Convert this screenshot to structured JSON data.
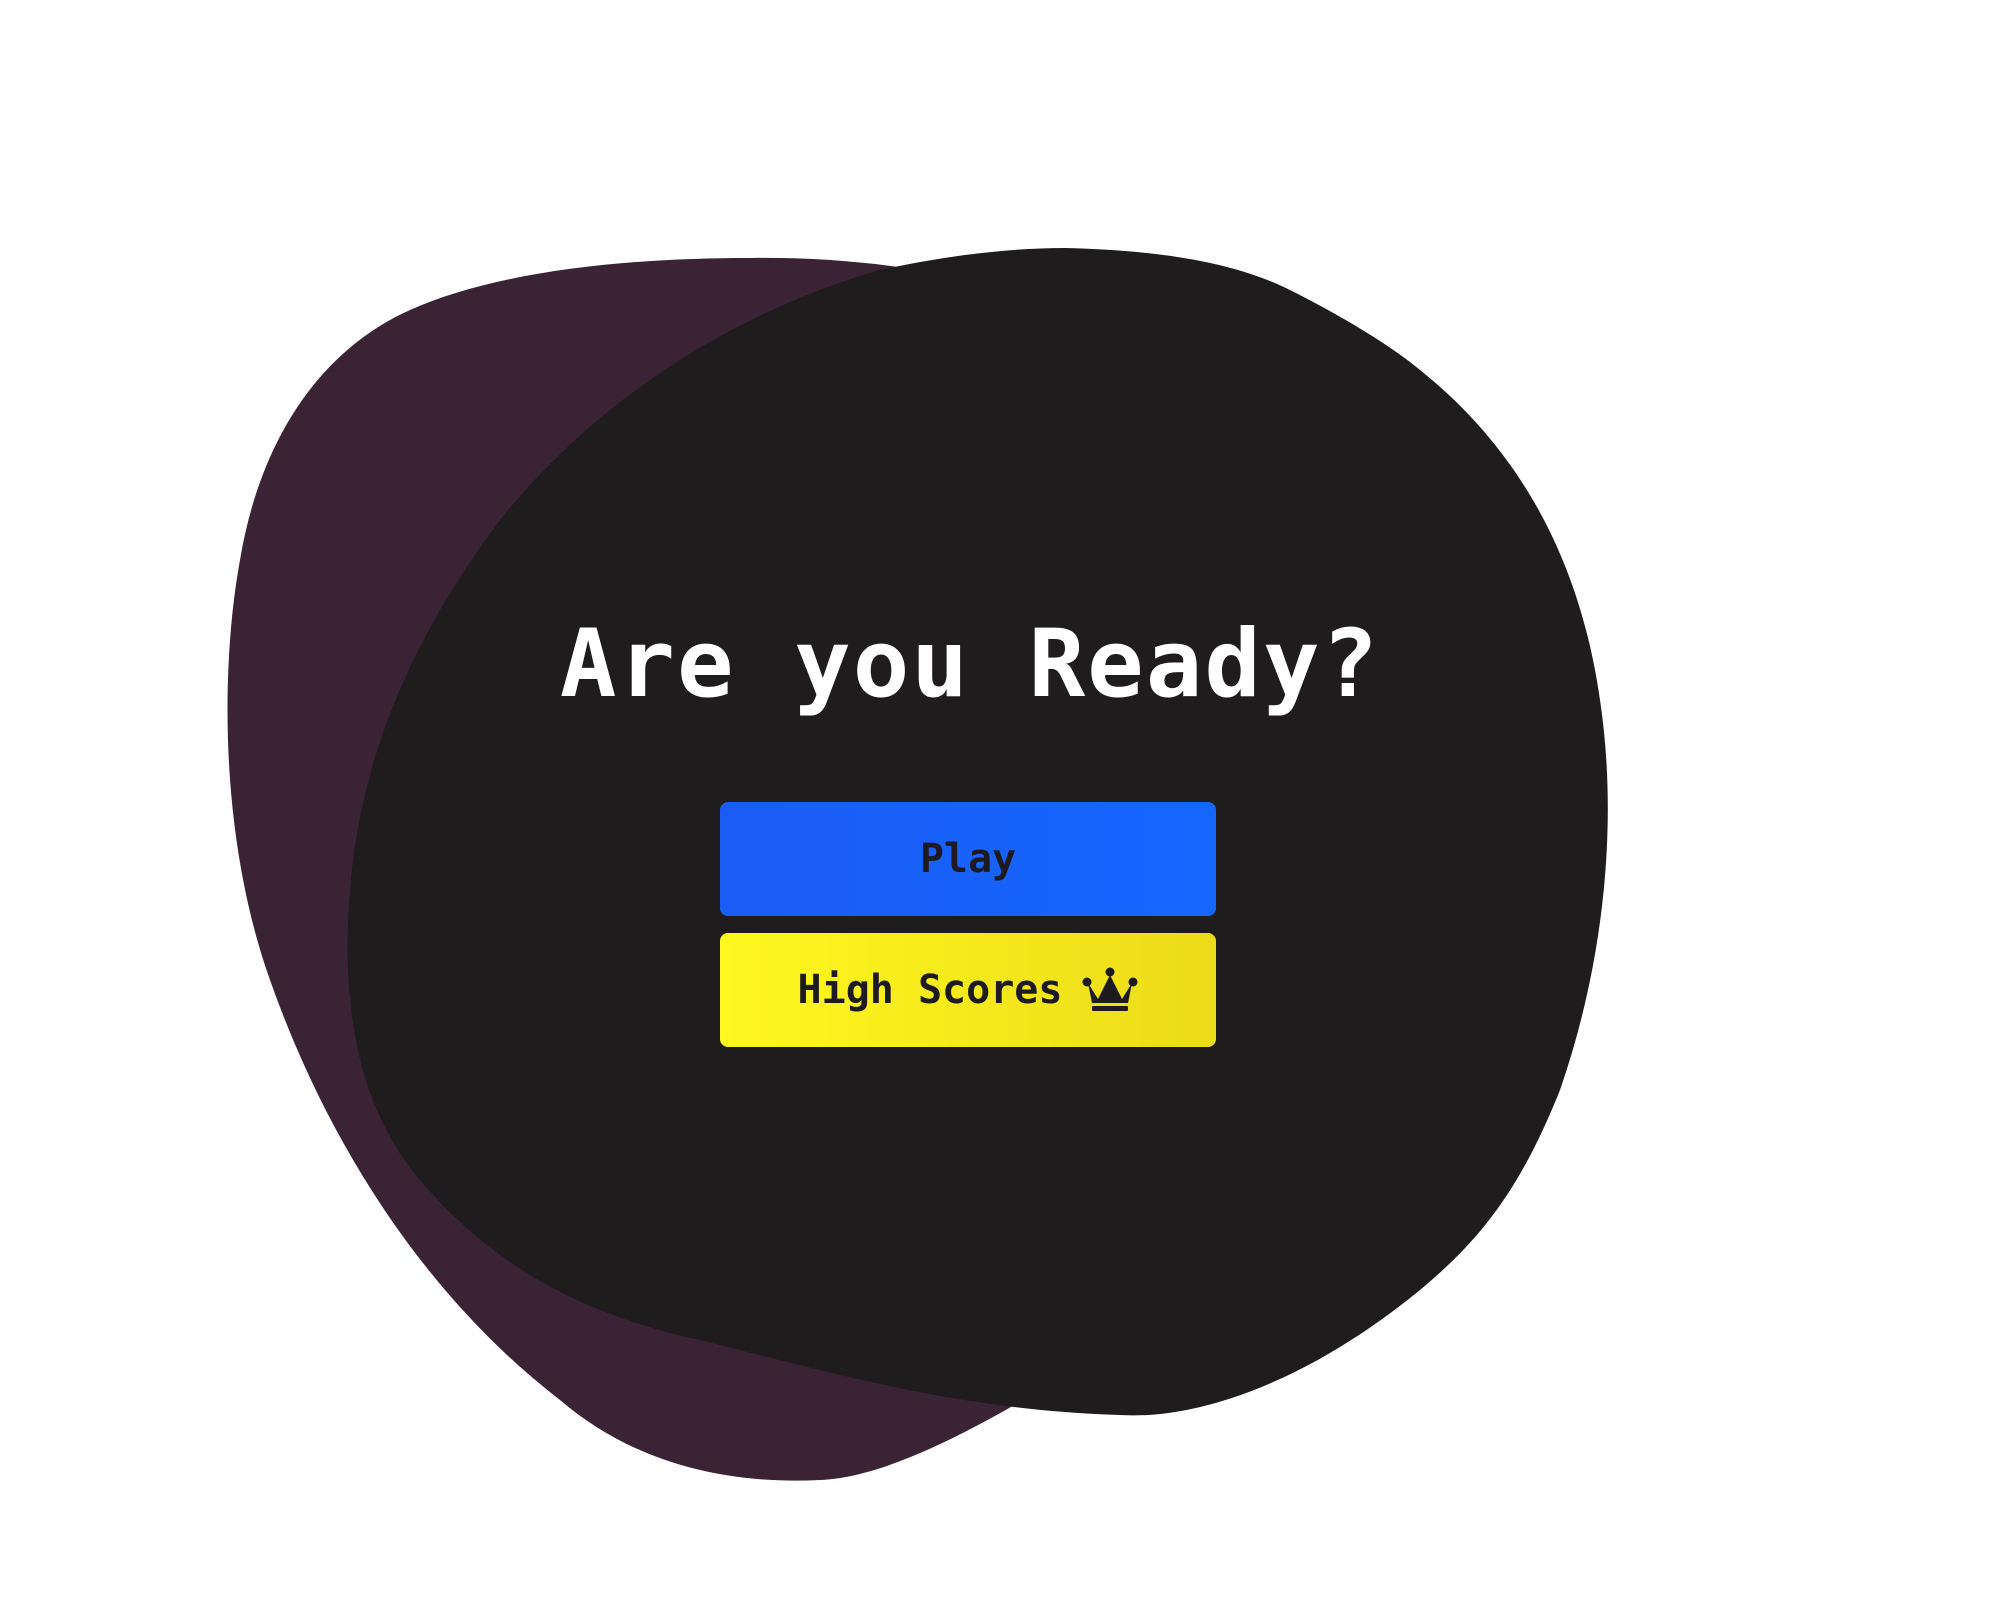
{
  "menu": {
    "title": "Are you Ready?",
    "play_label": "Play",
    "high_scores_label": "High Scores",
    "high_scores_icon": "crown-icon"
  },
  "colors": {
    "background": "#ffffff",
    "back_blob": "#3b2336",
    "front_blob": "#1e1c1c",
    "title_text": "#ffffff",
    "play_button": "#1a60fb",
    "high_scores_button": "#f8f11d",
    "button_text": "#1d1b1f"
  }
}
